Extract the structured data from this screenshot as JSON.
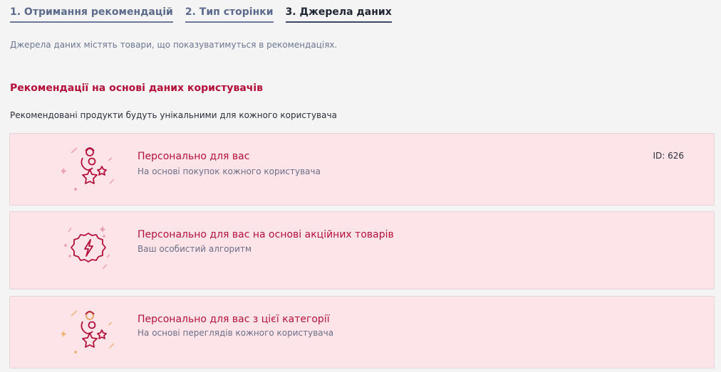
{
  "tabs": [
    {
      "label": "1. Отримання рекомендацій"
    },
    {
      "label": "2. Тип сторінки"
    },
    {
      "label": "3. Джерела даних"
    }
  ],
  "subtitle": "Джерела даних містять товари, що показуватимуться в рекомендаціях.",
  "section": {
    "title": "Рекомендації на основі даних користувачів",
    "description": "Рекомендовані продукти будуть унікальними для кожного користувача"
  },
  "cards": [
    {
      "title": "Персонально для вас",
      "description": "На основі покупок кожного користувача",
      "id": "ID: 626",
      "icon": "person-stars-icon"
    },
    {
      "title": "Персонально для вас на основі акційних товарів",
      "description": "Ваш особистий алгоритм",
      "icon": "lightning-badge-icon"
    },
    {
      "title": "Персонально для вас з цієї категорії",
      "description": "На основі переглядів кожного користувача",
      "icon": "person-stars-icon"
    }
  ],
  "colors": {
    "accent": "#b3103a",
    "card_bg": "#fde4e9",
    "icon_orange": "#e8a35a"
  }
}
